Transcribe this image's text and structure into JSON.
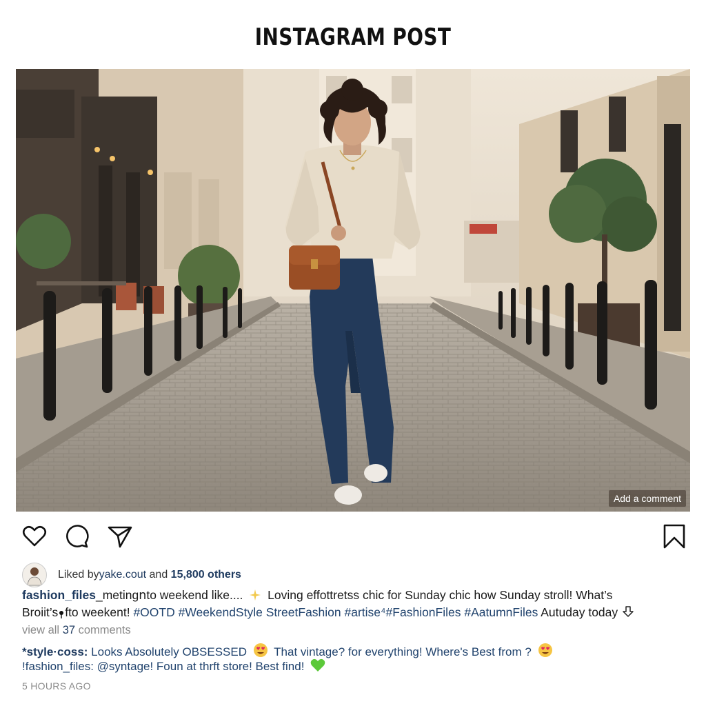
{
  "page": {
    "title": "INSTAGRAM POST"
  },
  "photo": {
    "add_comment_label": "Add a comment"
  },
  "actions": {
    "like_icon": "heart-icon",
    "comment_icon": "comment-bubble-icon",
    "share_icon": "paper-plane-icon",
    "save_icon": "bookmark-icon"
  },
  "likes": {
    "prefix": "Liked by",
    "user": "yake.cout",
    "and": " and ",
    "count": "15,800 others"
  },
  "caption": {
    "handle": "fashion_files",
    "text_1": "_meting",
    "text_2": "ոto weekend like.... ",
    "text_3": " Loving effottretss chic for Sunday chic how Sunday stroll! What’s",
    "text_4": "Broiit’s",
    "text_5": "fto weekent! ",
    "tags": "#OOTD #WeekendStyle StreetFashion #artise⁴#FashionFiles #AatumnFiles",
    "text_6": " Autuday today"
  },
  "view_comments": {
    "prefix": "view all ",
    "count": "37",
    "suffix": " comments"
  },
  "comments": [
    {
      "handle": "*style·coss:",
      "text_a": " Looks Absolutely OBSESSED ",
      "text_b": " That vintage? for everything! Where's Best from  ? "
    },
    {
      "handle": "!fashion_files:",
      "text_a": " @syntage! Foun at thrft store! Best find! "
    }
  ],
  "timestamp": "5 HOURS AGO",
  "colors": {
    "link_blue": "#1e3a5f",
    "hashtag_blue": "#22446e",
    "muted_gray": "#8a8a8a"
  }
}
